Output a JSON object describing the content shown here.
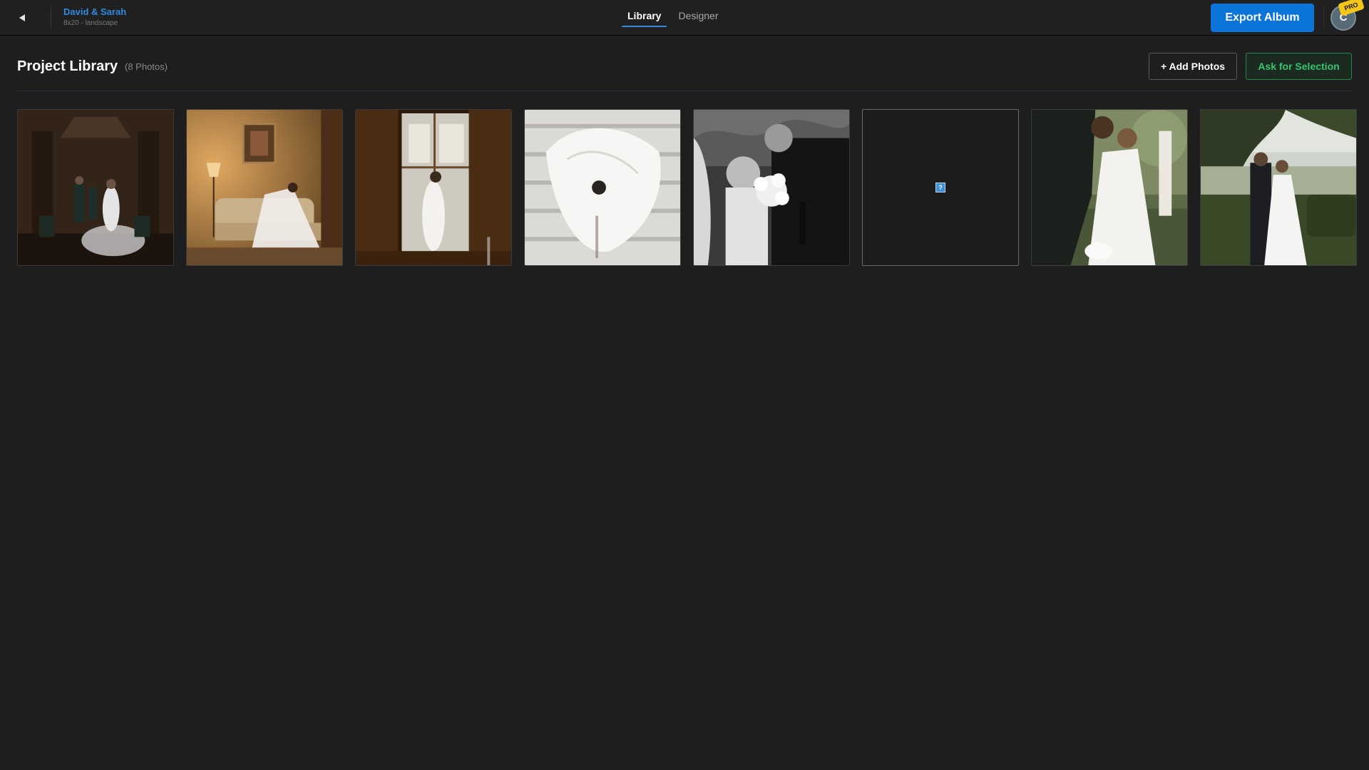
{
  "header": {
    "back_icon": "back-arrow-icon",
    "project_name": "David & Sarah",
    "project_meta": "8x20 - landscape",
    "tabs": [
      {
        "label": "Library",
        "active": true
      },
      {
        "label": "Designer",
        "active": false
      }
    ],
    "export_label": "Export Album",
    "avatar_initial": "C",
    "pro_badge": "PRO"
  },
  "library": {
    "title": "Project Library",
    "count_label": "(8 Photos)",
    "add_photos_label": "+ Add Photos",
    "ask_selection_label": "Ask for Selection",
    "photos": [
      {
        "name": "photo-bridal-party-dark-room",
        "status": "loaded"
      },
      {
        "name": "photo-bride-sofa-warm-lamp",
        "status": "loaded"
      },
      {
        "name": "photo-bride-window-silhouette",
        "status": "loaded"
      },
      {
        "name": "photo-bride-stairs-top-view",
        "status": "loaded"
      },
      {
        "name": "photo-couple-black-white-bouquet",
        "status": "loaded"
      },
      {
        "name": "photo-missing-placeholder",
        "status": "missing",
        "icon": "broken-image-icon"
      },
      {
        "name": "photo-couple-kiss-outdoor",
        "status": "loaded"
      },
      {
        "name": "photo-couple-garden-view",
        "status": "loaded"
      }
    ]
  },
  "colors": {
    "accent_blue": "#0a74d8",
    "link_blue": "#2f8ae0",
    "success_green": "#36c46e",
    "background": "#1e1e1e",
    "pro_yellow": "#f5c518"
  }
}
